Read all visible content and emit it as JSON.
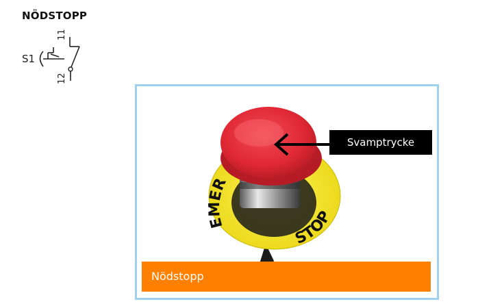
{
  "title": "NÖDSTOPP",
  "symbol": {
    "designator": "S1",
    "terminal_top": "11",
    "terminal_bottom": "12"
  },
  "photo": {
    "ring_text_left": "EMER",
    "ring_text_right": "STOP",
    "callout": "Svamptrycke",
    "caption": "Nödstopp"
  },
  "colors": {
    "frame": "#9fd0ee",
    "caption_bar": "#ff7f00",
    "callout_bg": "#000000",
    "button_red": "#e02835",
    "ring_yellow": "#f3e41c"
  }
}
